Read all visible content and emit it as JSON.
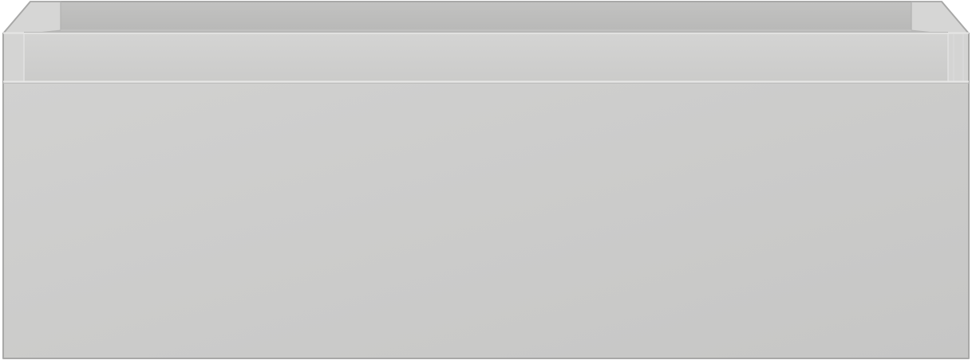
{
  "product": {
    "kind": "drawer-box",
    "finish_color": "#cbcbca",
    "colors": {
      "front_face": "#c9c9c8",
      "rim": "#d0d0cf",
      "inner_back": "#bcbcbc",
      "edge_highlight": "#e4e4e3",
      "outline": "#a9a9a8"
    }
  }
}
